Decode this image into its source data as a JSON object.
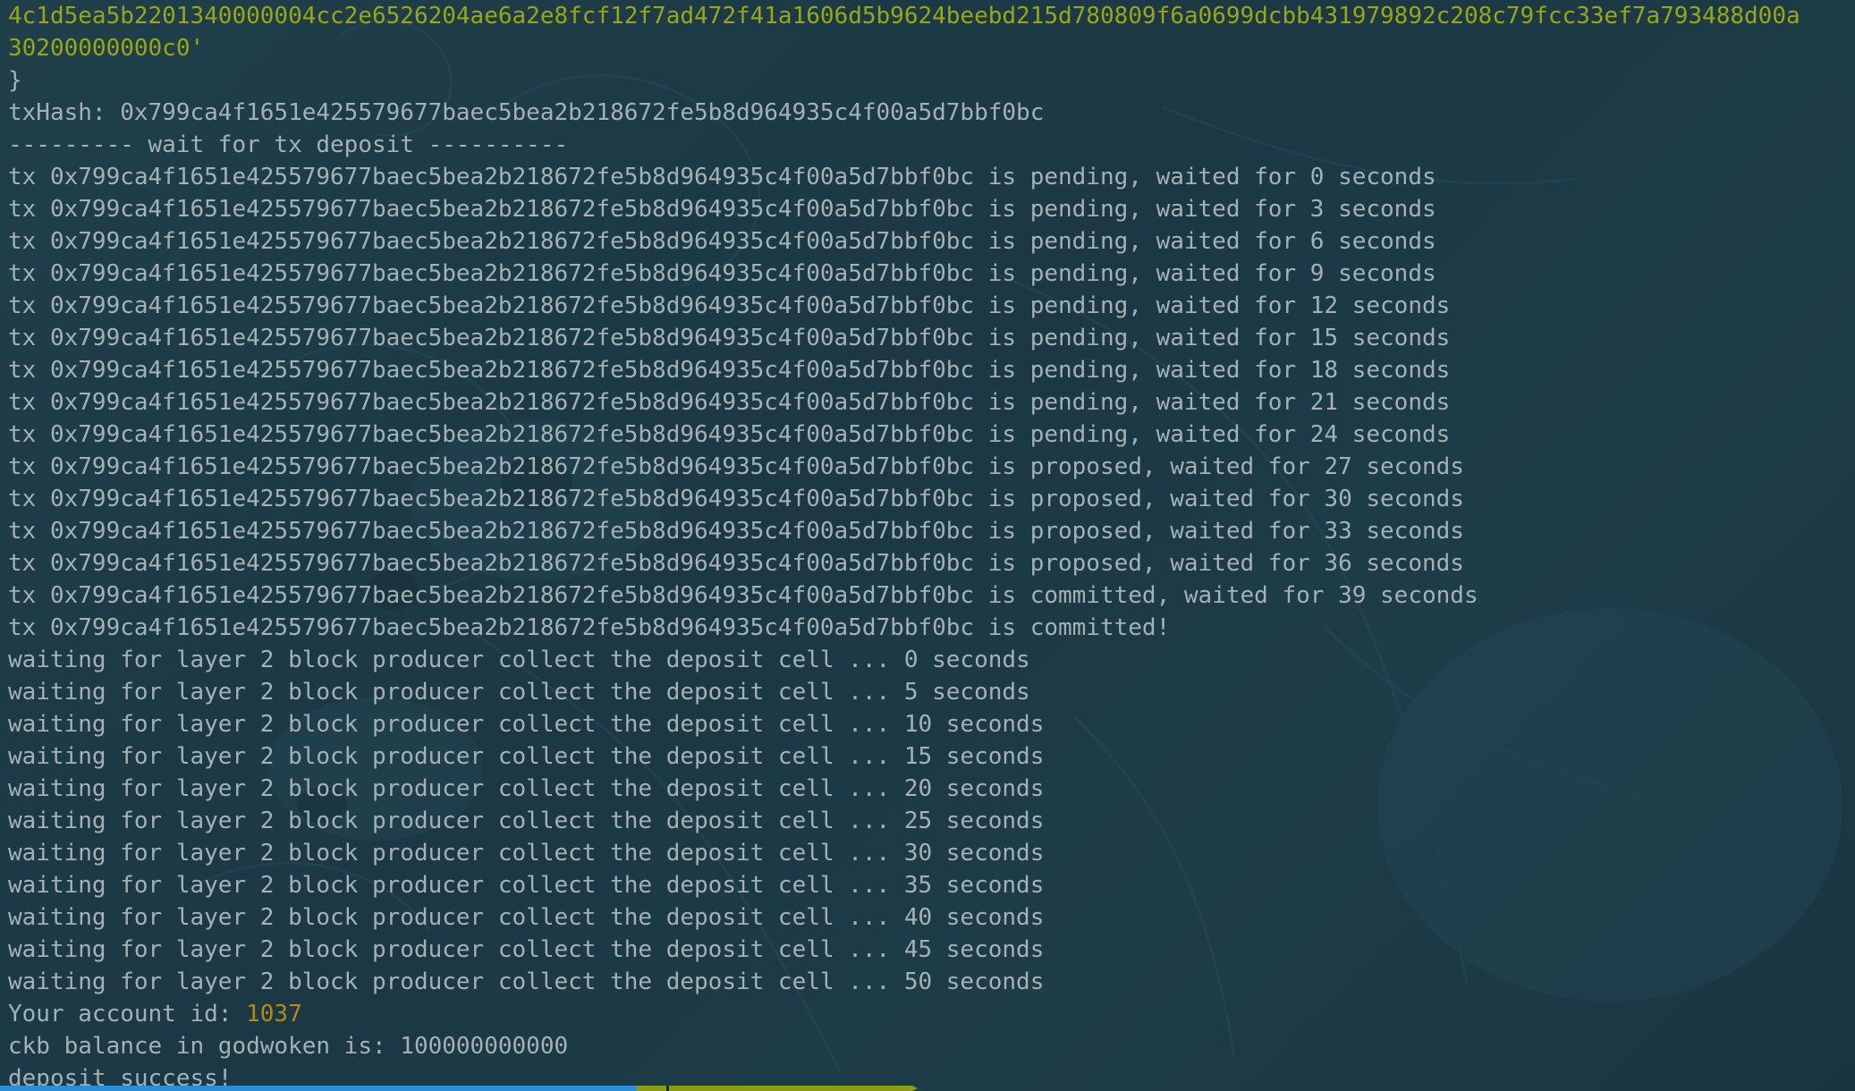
{
  "output": {
    "preamble": [
      {
        "text": "4c1d5ea5b2201340000004cc2e6526204ae6a2e8fcf12f7ad472f41a1606d5b9624beebd215d780809f6a0699dcbb431979892c208c79fcc33ef7a793488d00a",
        "kind": "hex"
      },
      {
        "text": "30200000000c0'",
        "kind": "hex"
      },
      {
        "text": "}",
        "kind": "plain"
      },
      {
        "text": "txHash: 0x799ca4f1651e425579677baec5bea2b218672fe5b8d964935c4f00a5d7bbf0bc",
        "kind": "plain"
      },
      {
        "text": "--------- wait for tx deposit ----------",
        "kind": "plain"
      }
    ],
    "tx_lines": [
      "tx 0x799ca4f1651e425579677baec5bea2b218672fe5b8d964935c4f00a5d7bbf0bc is pending, waited for 0 seconds",
      "tx 0x799ca4f1651e425579677baec5bea2b218672fe5b8d964935c4f00a5d7bbf0bc is pending, waited for 3 seconds",
      "tx 0x799ca4f1651e425579677baec5bea2b218672fe5b8d964935c4f00a5d7bbf0bc is pending, waited for 6 seconds",
      "tx 0x799ca4f1651e425579677baec5bea2b218672fe5b8d964935c4f00a5d7bbf0bc is pending, waited for 9 seconds",
      "tx 0x799ca4f1651e425579677baec5bea2b218672fe5b8d964935c4f00a5d7bbf0bc is pending, waited for 12 seconds",
      "tx 0x799ca4f1651e425579677baec5bea2b218672fe5b8d964935c4f00a5d7bbf0bc is pending, waited for 15 seconds",
      "tx 0x799ca4f1651e425579677baec5bea2b218672fe5b8d964935c4f00a5d7bbf0bc is pending, waited for 18 seconds",
      "tx 0x799ca4f1651e425579677baec5bea2b218672fe5b8d964935c4f00a5d7bbf0bc is pending, waited for 21 seconds",
      "tx 0x799ca4f1651e425579677baec5bea2b218672fe5b8d964935c4f00a5d7bbf0bc is pending, waited for 24 seconds",
      "tx 0x799ca4f1651e425579677baec5bea2b218672fe5b8d964935c4f00a5d7bbf0bc is proposed, waited for 27 seconds",
      "tx 0x799ca4f1651e425579677baec5bea2b218672fe5b8d964935c4f00a5d7bbf0bc is proposed, waited for 30 seconds",
      "tx 0x799ca4f1651e425579677baec5bea2b218672fe5b8d964935c4f00a5d7bbf0bc is proposed, waited for 33 seconds",
      "tx 0x799ca4f1651e425579677baec5bea2b218672fe5b8d964935c4f00a5d7bbf0bc is proposed, waited for 36 seconds",
      "tx 0x799ca4f1651e425579677baec5bea2b218672fe5b8d964935c4f00a5d7bbf0bc is committed, waited for 39 seconds",
      "tx 0x799ca4f1651e425579677baec5bea2b218672fe5b8d964935c4f00a5d7bbf0bc is committed!"
    ],
    "wait_lines": [
      "waiting for layer 2 block producer collect the deposit cell ... 0 seconds",
      "waiting for layer 2 block producer collect the deposit cell ... 5 seconds",
      "waiting for layer 2 block producer collect the deposit cell ... 10 seconds",
      "waiting for layer 2 block producer collect the deposit cell ... 15 seconds",
      "waiting for layer 2 block producer collect the deposit cell ... 20 seconds",
      "waiting for layer 2 block producer collect the deposit cell ... 25 seconds",
      "waiting for layer 2 block producer collect the deposit cell ... 30 seconds",
      "waiting for layer 2 block producer collect the deposit cell ... 35 seconds",
      "waiting for layer 2 block producer collect the deposit cell ... 40 seconds",
      "waiting for layer 2 block producer collect the deposit cell ... 45 seconds",
      "waiting for layer 2 block producer collect the deposit cell ... 50 seconds"
    ],
    "account_label": "Your account id: ",
    "account_id": "1037",
    "balance_line": "ckb balance in godwoken is: 100000000000",
    "success_line": "deposit success!"
  },
  "colors": {
    "background": "#1d3b47",
    "text": "#a4b1b5",
    "hex_text": "#99a617",
    "number_highlight": "#b58914",
    "statusbar_blue": "#2b8fd6",
    "statusbar_green": "#8c9c16"
  }
}
